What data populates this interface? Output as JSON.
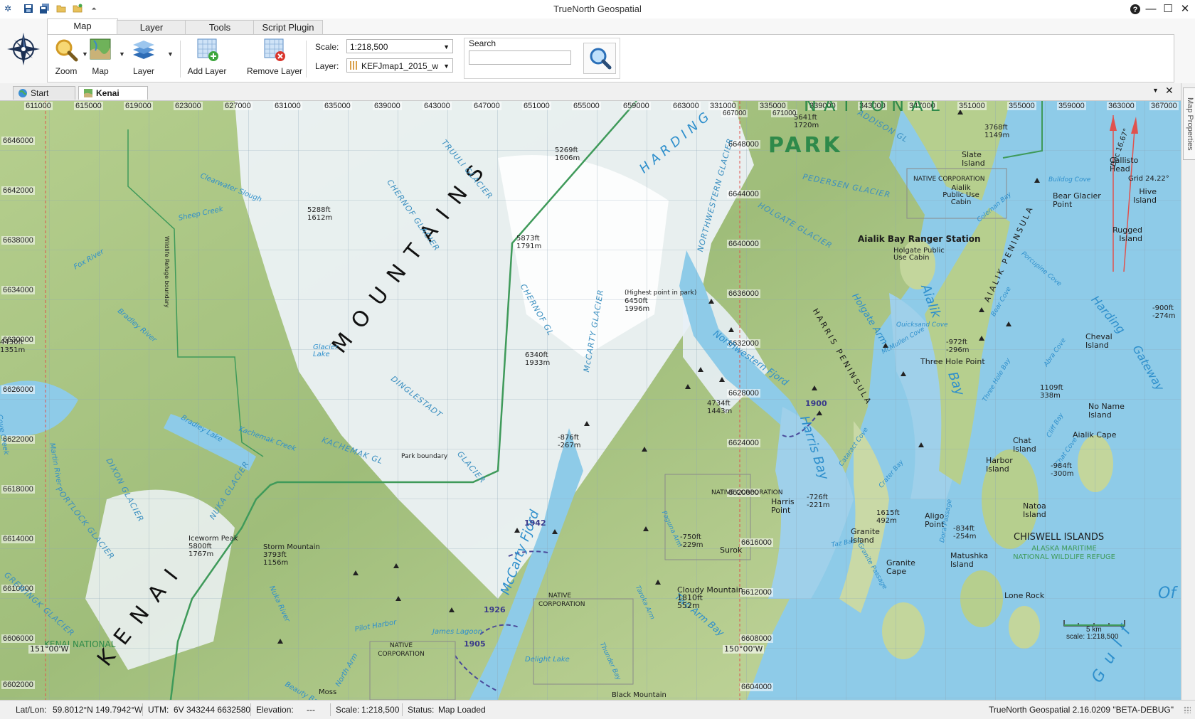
{
  "app": {
    "title": "TrueNorth Geospatial",
    "colors": {
      "accent": "#1f6fb8",
      "chrome": "#f0f0f0",
      "park_boundary": "#3f9a5a",
      "water": "#8ecbe8"
    }
  },
  "titlebar": {
    "quick_access": [
      "app-menu-icon",
      "save-icon",
      "save-all-icon",
      "open-folder-icon",
      "new-folder-icon",
      "customize-icon"
    ],
    "help_label": "?",
    "minimize_label": "—",
    "maximize_label": "☐",
    "close_label": "✕"
  },
  "ribbon": {
    "tabs": [
      "Map",
      "Layer",
      "Tools",
      "Script Plugin"
    ],
    "active_tab": "Map",
    "buttons": {
      "zoom": "Zoom",
      "map": "Map",
      "layer": "Layer",
      "add_layer": "Add Layer",
      "remove_layer": "Remove Layer"
    },
    "scale_label": "Scale:",
    "scale_value": "1:218,500",
    "layer_label": "Layer:",
    "layer_value": "KEFJmap1_2015_w",
    "search_label": "Search",
    "search_value": ""
  },
  "doc_tabs": {
    "tabs": [
      "Start Page",
      "Kenai Fjords"
    ],
    "active": "Kenai Fjords"
  },
  "side_panel": {
    "label": "Map Properties"
  },
  "map": {
    "top_grid": [
      "611000",
      "615000",
      "619000",
      "623000",
      "627000",
      "631000",
      "635000",
      "639000",
      "643000",
      "647000",
      "651000",
      "655000",
      "659000",
      "663000",
      "331000",
      "335000",
      "339000",
      "343000",
      "347000",
      "351000",
      "355000",
      "359000",
      "363000",
      "367000"
    ],
    "top_grid_extra": [
      "667000",
      "671000"
    ],
    "left_grid": [
      "6646000",
      "6642000",
      "6638000",
      "6634000",
      "6630000",
      "6626000",
      "6622000",
      "6618000",
      "6614000",
      "6610000",
      "6606000",
      "6602000"
    ],
    "mid_grid": [
      "6648000",
      "6644000",
      "6640000",
      "6636000",
      "6632000",
      "6628000",
      "6624000",
      "6620000",
      "6616000",
      "6612000",
      "6608000",
      "6604000"
    ],
    "big_labels": {
      "mountains": "MOUNTAINS",
      "kenai": "KENAI",
      "park": "PARK",
      "harding": "HARDING",
      "national": "NATIONAL"
    },
    "glaciers": [
      "TRUULI GLACIER",
      "CHERNOF GLACIER",
      "DINGLESTADT",
      "KACHEMAK GL",
      "DIXON GLACIER",
      "PORTLOCK GLACIER",
      "GREWINGK GLACIER",
      "NUKA GLACIER",
      "CHERNOF GL",
      "McCARTY GLACIER",
      "NORTHWESTERN GLACIER",
      "PEDERSEN GLACIER",
      "HOLGATE GLACIER",
      "ADDISON GL",
      "GLACIER"
    ],
    "waters": [
      "Aialik",
      "Bay",
      "Harris Bay",
      "Northwestern Fjord",
      "McCarty Fjord",
      "Holgate Arm",
      "Harding",
      "Gateway",
      "Bear Cove",
      "Quicksand Cove",
      "McMullen Cove",
      "Coleman Bay",
      "Porcupine Cove",
      "Bulldog Cove",
      "Two Arm Bay",
      "Pilot Harbor",
      "James Lagoon",
      "North Arm",
      "Delight Lake",
      "Paguna Arm",
      "Taroka Arm",
      "Thunder Bay",
      "Cataract Cove",
      "Crater Bay",
      "Taz Basin",
      "Granite Passage",
      "Dora Passage",
      "Three Hole Bay",
      "Abra Cove",
      "Cliff Bay",
      "Chat Cove",
      "Of",
      "Gulf",
      "Bradley Lake",
      "Glacier Lake",
      "Fox River",
      "Sheep Creek",
      "Bradley River",
      "Clearwater Slough",
      "Kachemak Creek",
      "Martin River",
      "Cove Creek",
      "Nuka River",
      "Beauty Bay",
      "Harris Bay"
    ],
    "peaks": [
      {
        "ft": "5288ft",
        "m": "1612m"
      },
      {
        "ft": "5269ft",
        "m": "1606m"
      },
      {
        "ft": "5873ft",
        "m": "1791m"
      },
      {
        "ft": "6340ft",
        "m": "1933m"
      },
      {
        "ft": "6450ft",
        "m": "1996m"
      },
      {
        "ft": "4430ft",
        "m": "1351m"
      },
      {
        "ft": "4734ft",
        "m": "1443m"
      },
      {
        "ft": "5641ft",
        "m": "1720m"
      },
      {
        "ft": "3768ft",
        "m": "1149m"
      },
      {
        "ft": "-876ft",
        "m": "-267m"
      },
      {
        "ft": "-750ft",
        "m": "-229m"
      },
      {
        "ft": "-726ft",
        "m": "-221m"
      },
      {
        "ft": "-972ft",
        "m": "-296m"
      },
      {
        "ft": "-834ft",
        "m": "-254m"
      },
      {
        "ft": "-984ft",
        "m": "-300m"
      },
      {
        "ft": "-900ft",
        "m": "-274m"
      },
      {
        "ft": "1109ft",
        "m": "338m"
      },
      {
        "ft": "1615ft",
        "m": "492m"
      }
    ],
    "places": [
      "Slate Island",
      "NATIVE CORPORATION",
      "Aialik Public Use Cabin",
      "Aialik Bay Ranger Station",
      "Holgate Public Use Cabin",
      "Bear Glacier Point",
      "Callisto Head",
      "Hive Island",
      "Rugged Island",
      "HARRIS PENINSULA",
      "AIALIK PENINSULA",
      "Three Hole Point",
      "Cheval Island",
      "No Name Island",
      "Aialik Cape",
      "Chat Island",
      "Harbor Island",
      "Natoa Island",
      "CHISWELL ISLANDS",
      "ALASKA MARITIME NATIONAL WILDLIFE REFUGE",
      "Aligo Point",
      "Granite Island",
      "Granite Cape",
      "Matushka Island",
      "Lone Rock",
      "Harris Point",
      "Surok",
      "Cloudy Mountain",
      "Iceworm Peak",
      "Storm Mountain",
      "Park boundary",
      "Wildlife Refuge boundary",
      "KENAI NATIONAL",
      "Moss",
      "Black Mountain",
      "(Highest point in park)"
    ],
    "mountain_peaks": [
      {
        "name": "Cloudy Mountain",
        "ft": "1810ft",
        "m": "552m"
      },
      {
        "name": "Iceworm Peak",
        "ft": "5800ft",
        "m": "1767m"
      },
      {
        "name": "Storm Mountain",
        "ft": "3793ft",
        "m": "1156m"
      }
    ],
    "years": [
      "1900",
      "1942",
      "1926",
      "1905"
    ],
    "meridians": [
      "151°00'W",
      "150°00'W"
    ],
    "grid_note": "Grid 24.22°",
    "declination": "Dec 16.67°",
    "scalebar": {
      "distance": "5 km",
      "scale": "scale: 1:218,500"
    }
  },
  "status": {
    "latlon_label": "Lat/Lon:",
    "latlon_value": "59.8012°N 149.7942°W",
    "utm_label": "UTM:",
    "utm_value": "6V 343244 6632580",
    "elevation_label": "Elevation:",
    "elevation_value": "---",
    "scale_label": "Scale:",
    "scale_value": "1:218,500",
    "status_label": "Status:",
    "status_value": "Map Loaded",
    "version": "TrueNorth Geospatial 2.16.0209 \"BETA-DEBUG\""
  }
}
